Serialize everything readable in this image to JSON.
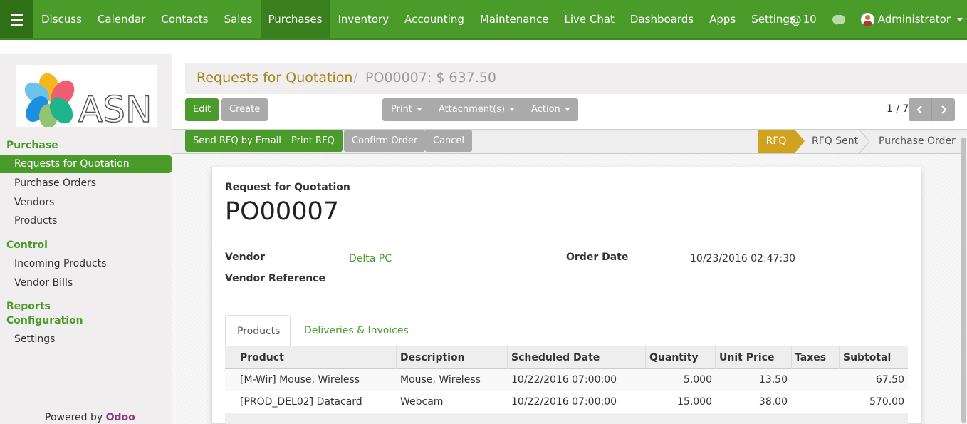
{
  "navbar": {
    "menu": [
      "Discuss",
      "Calendar",
      "Contacts",
      "Sales",
      "Purchases",
      "Inventory",
      "Accounting",
      "Maintenance",
      "Live Chat",
      "Dashboards",
      "Apps",
      "Settings"
    ],
    "active_menu": "Purchases",
    "mentions_count": "10",
    "user": "Administrator",
    "accent": "#4a9b2a"
  },
  "sidebar": {
    "logo_text": "ASN",
    "sections": {
      "purchase": "Purchase",
      "control": "Control",
      "reports": "Reports",
      "configuration": "Configuration"
    },
    "items": {
      "rfq": "Requests for Quotation",
      "purchase_orders": "Purchase Orders",
      "vendors": "Vendors",
      "products": "Products",
      "incoming_products": "Incoming Products",
      "vendor_bills": "Vendor Bills",
      "settings": "Settings"
    },
    "powered_by": "Powered by",
    "powered_brand": "Odoo"
  },
  "breadcrumb": {
    "parent": "Requests for Quotation",
    "separator": "/",
    "current": "PO00007: $ 637.50"
  },
  "toolbar": {
    "edit": "Edit",
    "create": "Create",
    "print": "Print",
    "attachments": "Attachment(s)",
    "action": "Action",
    "pager": "1 / 7"
  },
  "statusbar": {
    "send_rfq": "Send RFQ by Email",
    "print_rfq": "Print RFQ",
    "confirm_order": "Confirm Order",
    "cancel": "Cancel",
    "stages": [
      "RFQ",
      "RFQ Sent",
      "Purchase Order"
    ],
    "active_stage": "RFQ"
  },
  "form": {
    "doc_type": "Request for Quotation",
    "name": "PO00007",
    "vendor_label": "Vendor",
    "vendor_value": "Delta PC",
    "vendor_ref_label": "Vendor Reference",
    "order_date_label": "Order Date",
    "order_date_value": "10/23/2016 02:47:30"
  },
  "tabs": [
    "Products",
    "Deliveries & Invoices"
  ],
  "lines": {
    "columns": [
      "Product",
      "Description",
      "Scheduled Date",
      "Quantity",
      "Unit Price",
      "Taxes",
      "Subtotal"
    ],
    "rows": [
      {
        "product": "[M-Wir] Mouse, Wireless",
        "description": "Mouse, Wireless",
        "date": "10/22/2016 07:00:00",
        "qty": "5.000",
        "price": "13.50",
        "taxes": "",
        "subtotal": "67.50"
      },
      {
        "product": "[PROD_DEL02] Datacard",
        "description": "Webcam",
        "date": "10/22/2016 07:00:00",
        "qty": "15.000",
        "price": "38.00",
        "taxes": "",
        "subtotal": "570.00"
      }
    ]
  }
}
